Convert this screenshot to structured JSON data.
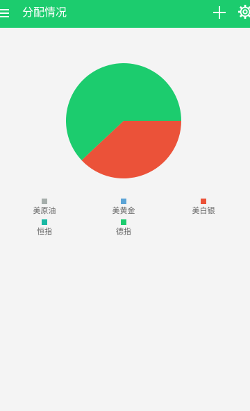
{
  "app_bar": {
    "title": "分配情况",
    "background": "#1ccc6e",
    "icons": [
      "menu-icon",
      "add-icon",
      "gear-icon"
    ]
  },
  "chart_data": {
    "type": "pie",
    "slices": [
      {
        "name": "美原油",
        "value": 0,
        "color": "#a6aeab"
      },
      {
        "name": "美黄金",
        "value": 0,
        "color": "#5ba4d6"
      },
      {
        "name": "美白银",
        "value": 38,
        "color": "#eb5239"
      },
      {
        "name": "恒指",
        "value": 0,
        "color": "#17b8a3"
      },
      {
        "name": "德指",
        "value": 62,
        "color": "#1ccc6e"
      }
    ],
    "legend": "bottom"
  }
}
